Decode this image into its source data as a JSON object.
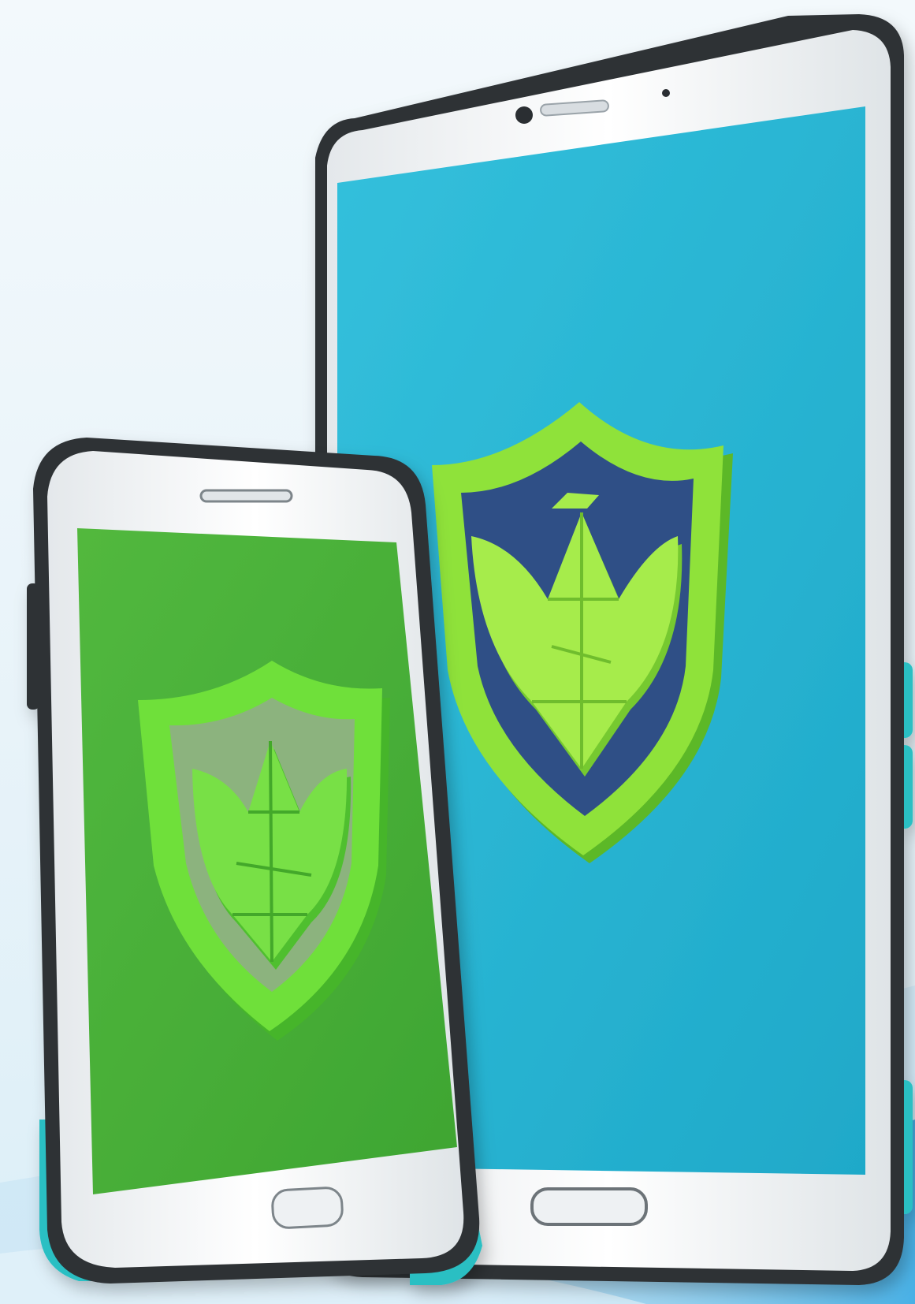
{
  "scene": {
    "background_top": "#f3f9fc",
    "background_bottom": "#d6eef9",
    "swoosh_color": "#1f9fe0"
  },
  "tablet": {
    "bezel_color": "#2f3336",
    "frame_color": "#f1f4f6",
    "screen_color": "#1fa9c9",
    "screen_color_light": "#33c0dc",
    "side_button_color": "#2bbfc3",
    "shield": {
      "icon": "shield-icon",
      "rim_color": "#8fe23a",
      "rim_shadow": "#5cb827",
      "inner_color": "#2f4f86",
      "emblem_color": "#a6ec4b",
      "emblem_shadow": "#76c930"
    }
  },
  "phone": {
    "bezel_color": "#2f3336",
    "frame_color": "#eef1f3",
    "screen_color": "#3ea532",
    "screen_color_light": "#52b83e",
    "bumper_color": "#2bbfc3",
    "shield": {
      "icon": "shield-icon",
      "rim_color": "#6fe03a",
      "rim_shadow": "#46b52a",
      "inner_color": "#8fae86",
      "emblem_color": "#78e046",
      "emblem_shadow": "#4fbf2f"
    }
  }
}
